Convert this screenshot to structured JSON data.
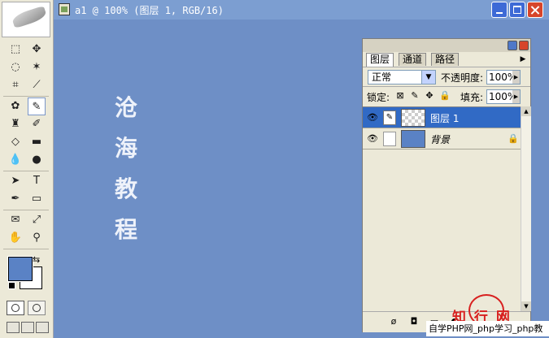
{
  "document": {
    "title": "a1 @ 100% (图层 1, RGB/16)"
  },
  "canvas": {
    "text_chars": [
      "沧",
      "海",
      "教",
      "程"
    ]
  },
  "tools": {
    "colors": {
      "foreground": "#5a82c5",
      "background": "#ffffff"
    }
  },
  "layers_panel": {
    "tabs": [
      {
        "label": "图层"
      },
      {
        "label": "通道"
      },
      {
        "label": "路径"
      }
    ],
    "blend_mode": "正常",
    "opacity_label": "不透明度:",
    "opacity_value": "100%",
    "lock_label": "锁定:",
    "fill_label": "填充:",
    "fill_value": "100%",
    "layers": [
      {
        "name": "图层 1",
        "selected": true,
        "visible": true
      },
      {
        "name": "背景",
        "selected": false,
        "visible": true,
        "locked": true
      }
    ]
  },
  "watermark": {
    "brand": "知 行 网",
    "text": "自学PHP网_php学习_php教"
  }
}
